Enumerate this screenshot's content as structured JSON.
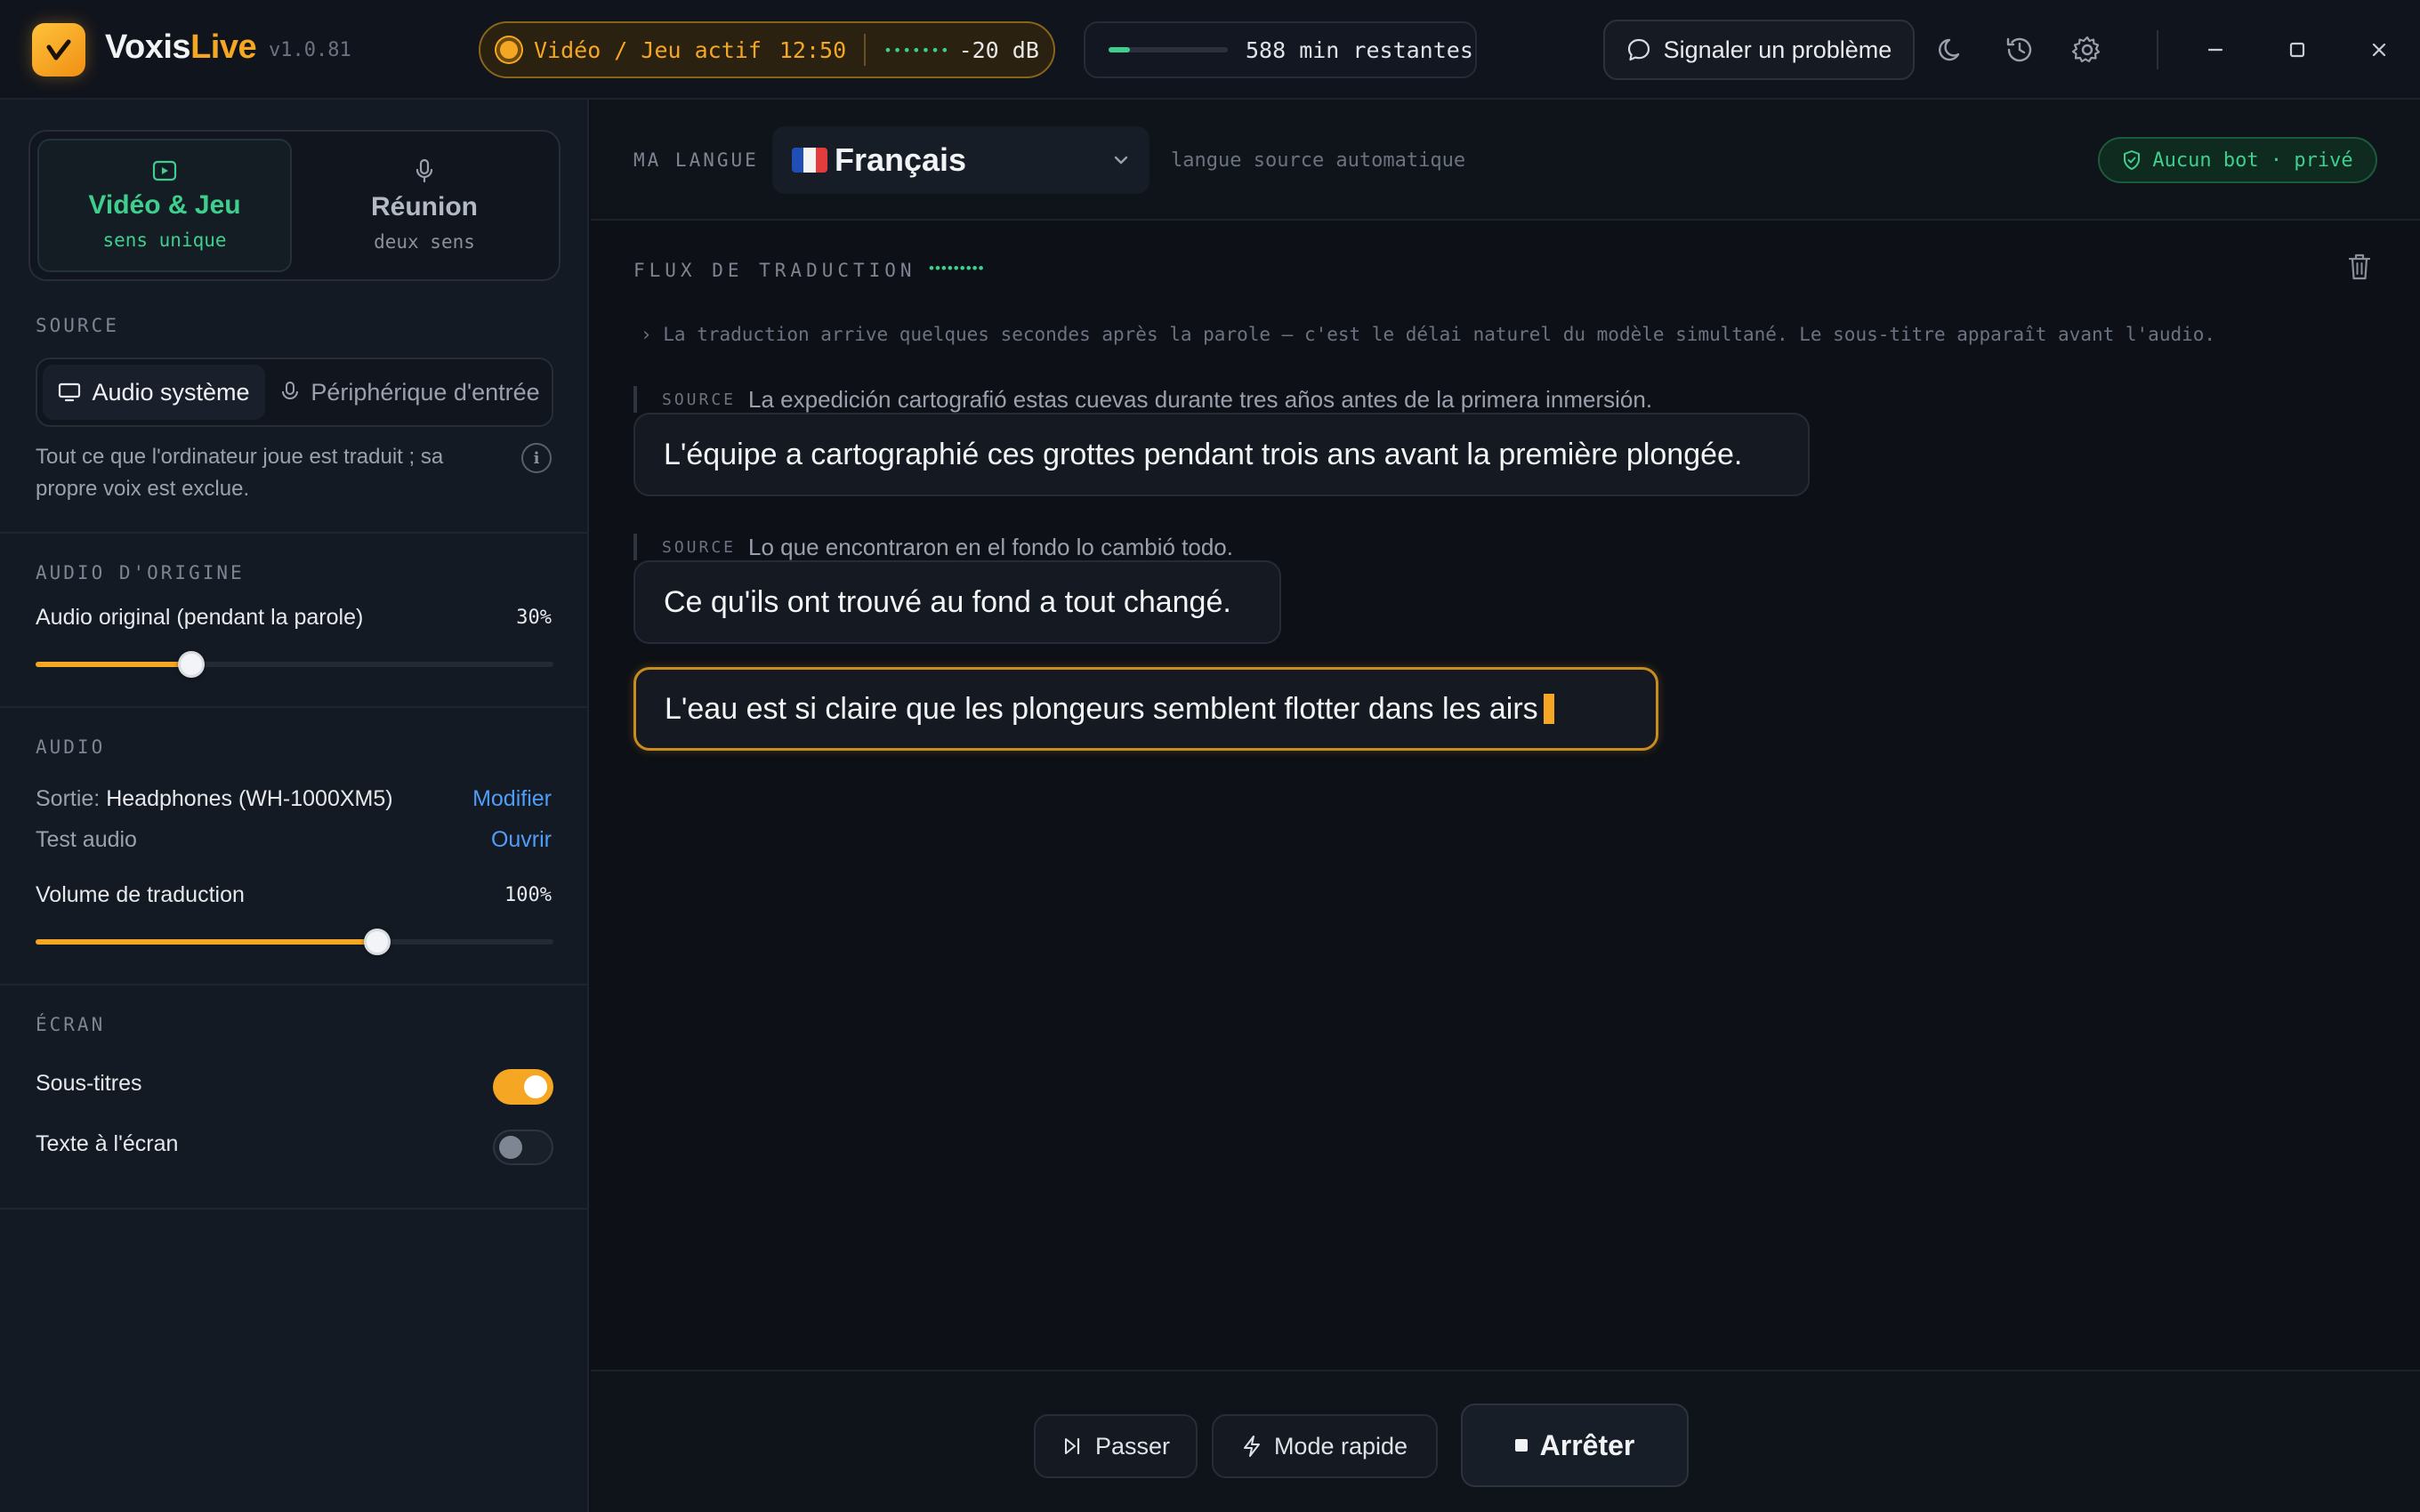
{
  "app": {
    "name_part1": "Voxis",
    "name_part2": "Live",
    "version": "v1.0.81",
    "brand_color": "#f5a623"
  },
  "topbar": {
    "mode_status": "Vidéo / Jeu actif",
    "timer": "12:50",
    "level_meter": "•••••••",
    "level_db": "-20 dB",
    "quota_fraction": 0.18,
    "quota_text": "588 min restantes",
    "report_label": "Signaler un problème",
    "icons": [
      "moon-icon",
      "history-icon",
      "gear-icon",
      "minimize-icon",
      "maximize-icon",
      "close-icon"
    ]
  },
  "sidebar": {
    "modes": [
      {
        "title": "Vidéo & Jeu",
        "subtitle": "sens unique",
        "active": true,
        "icon": "play-icon"
      },
      {
        "title": "Réunion",
        "subtitle": "deux sens",
        "active": false,
        "icon": "mic-icon"
      }
    ],
    "source": {
      "heading": "SOURCE",
      "options": [
        "Audio système",
        "Périphérique d'entrée"
      ],
      "selected": "Audio système",
      "description": "Tout ce que l'ordinateur joue est traduit ; sa propre voix est exclue."
    },
    "original_audio": {
      "heading": "AUDIO D'ORIGINE",
      "label": "Audio original (pendant la parole)",
      "value_text": "30%",
      "value": 0.3
    },
    "audio": {
      "heading": "AUDIO",
      "output_prefix": "Sortie:",
      "output_device": "Headphones (WH-1000XM5)",
      "output_action": "Modifier",
      "test_label": "Test audio",
      "test_action": "Ouvrir",
      "volume_label": "Volume de traduction",
      "volume_text": "100%",
      "volume": 0.66
    },
    "screen": {
      "heading": "ÉCRAN",
      "subtitles_label": "Sous-titres",
      "subtitles_on": true,
      "text_label": "Texte à l'écran",
      "text_on": false
    }
  },
  "main": {
    "lang_label": "MA LANGUE",
    "language": "Français",
    "lang_auto": "langue source automatique",
    "privacy": "Aucun bot · privé",
    "flux_label": "FLUX DE TRADUCTION",
    "flux_dots": "•••••••••",
    "hint": "› La traduction arrive quelques secondes après la parole — c'est le délai naturel du modèle simultané. Le sous-titre apparaît avant l'audio.",
    "source_tag": "SOURCE",
    "entries": [
      {
        "source": "La expedición cartografió estas cuevas durante tres años antes de la primera inmersión.",
        "translation": "L'équipe a cartographié ces grottes pendant trois ans avant la première plongée."
      },
      {
        "source": "Lo que encontraron en el fondo lo cambió todo.",
        "translation": "Ce qu'ils ont trouvé au fond a tout changé."
      }
    ],
    "live_translation": "L'eau est si claire que les plongeurs semblent flotter dans les airs"
  },
  "footer": {
    "skip_label": "Passer",
    "fast_label": "Mode rapide",
    "stop_label": "Arrêter"
  }
}
